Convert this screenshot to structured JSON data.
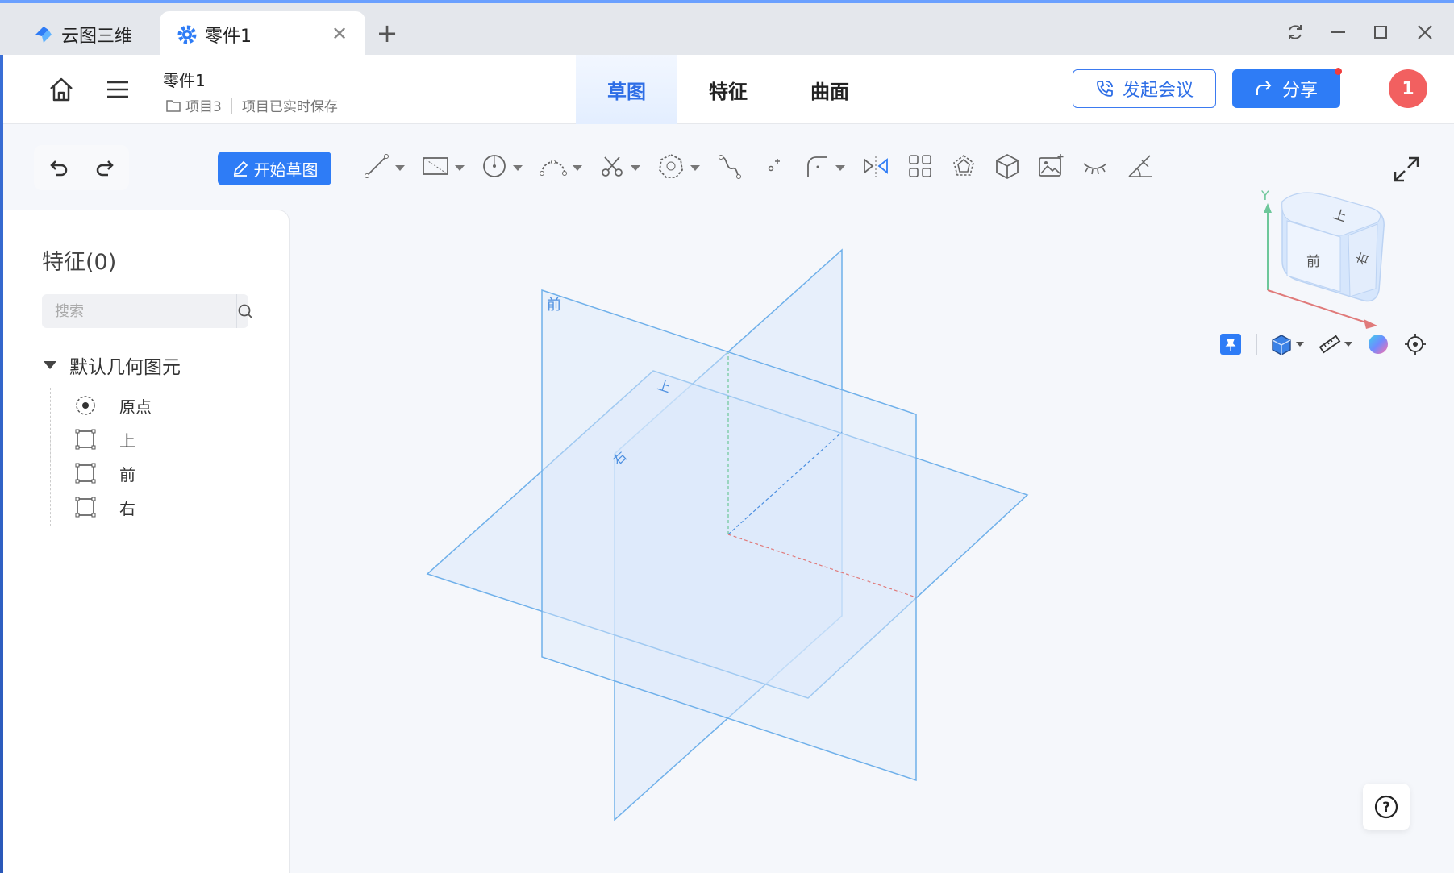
{
  "browser": {
    "home_tab_label": "云图三维",
    "active_tab_label": "零件1",
    "close_glyph": "✕",
    "new_tab_glyph": "+"
  },
  "header": {
    "doc_title": "零件1",
    "project_name": "项目3",
    "save_status": "项目已实时保存",
    "mode_tabs": [
      {
        "label": "草图",
        "active": true
      },
      {
        "label": "特征",
        "active": false
      },
      {
        "label": "曲面",
        "active": false
      }
    ],
    "meeting_button": "发起会议",
    "share_button": "分享",
    "avatar_text": "1"
  },
  "toolbar": {
    "start_sketch_label": "开始草图"
  },
  "panel": {
    "title": "特征(0)",
    "search_placeholder": "搜索",
    "group_label": "默认几何图元",
    "items": [
      {
        "label": "原点",
        "icon": "origin-icon"
      },
      {
        "label": "上",
        "icon": "plane-icon"
      },
      {
        "label": "前",
        "icon": "plane-icon"
      },
      {
        "label": "右",
        "icon": "plane-icon"
      }
    ]
  },
  "scene": {
    "plane_labels": {
      "front": "前",
      "top": "上",
      "right": "右"
    }
  },
  "viewcube": {
    "faces": {
      "top": "上",
      "front": "前",
      "right": "右"
    },
    "axis_y": "Y"
  },
  "colors": {
    "accent": "#2e7cf6",
    "plane_stroke": "#6fb0ea",
    "plane_fill": "#dbe9fb",
    "avatar": "#f26060"
  },
  "help_glyph": "?"
}
